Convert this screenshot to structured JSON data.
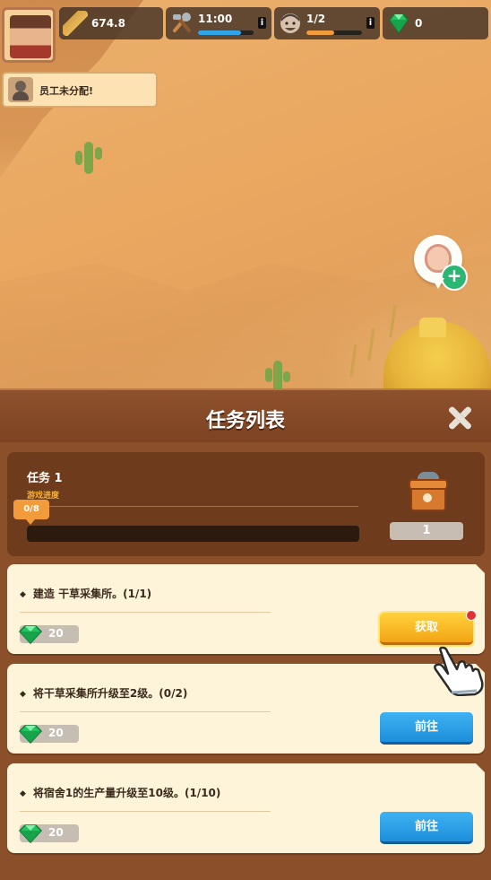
{
  "hud": {
    "hay_value": "674.8",
    "tools_time": "11:00",
    "tools_progress": 0.78,
    "workers": "1/2",
    "workers_progress": 0.5,
    "gems": "0",
    "info_label": "i"
  },
  "notice": {
    "text": "员工未分配!"
  },
  "panel": {
    "title": "任务列表",
    "task_name": "任务 1",
    "progress_label": "游戏进度",
    "progress_badge": "0/8",
    "progress": 0,
    "chest_count": "1"
  },
  "tasks": [
    {
      "desc": "建造 干草采集所。(1/1)",
      "reward": "20",
      "button": "获取",
      "state": "claim"
    },
    {
      "desc": "将干草采集所升级至2级。(0/2)",
      "reward": "20",
      "button": "前往",
      "state": "go"
    },
    {
      "desc": "将宿舍1的生产量升级至10级。(1/10)",
      "reward": "20",
      "button": "前往",
      "state": "go"
    }
  ],
  "colors": {
    "panel": "#8b4f2a",
    "card": "#fdf4d9",
    "go_button": "#2a9fe8",
    "claim_button": "#f8bb25",
    "gem": "#22c55e"
  },
  "icons": [
    "hero-portrait",
    "hay-icon",
    "tools-icon",
    "worker-icon",
    "gem-icon",
    "close-icon",
    "chest-icon",
    "pointer-hand-icon"
  ]
}
